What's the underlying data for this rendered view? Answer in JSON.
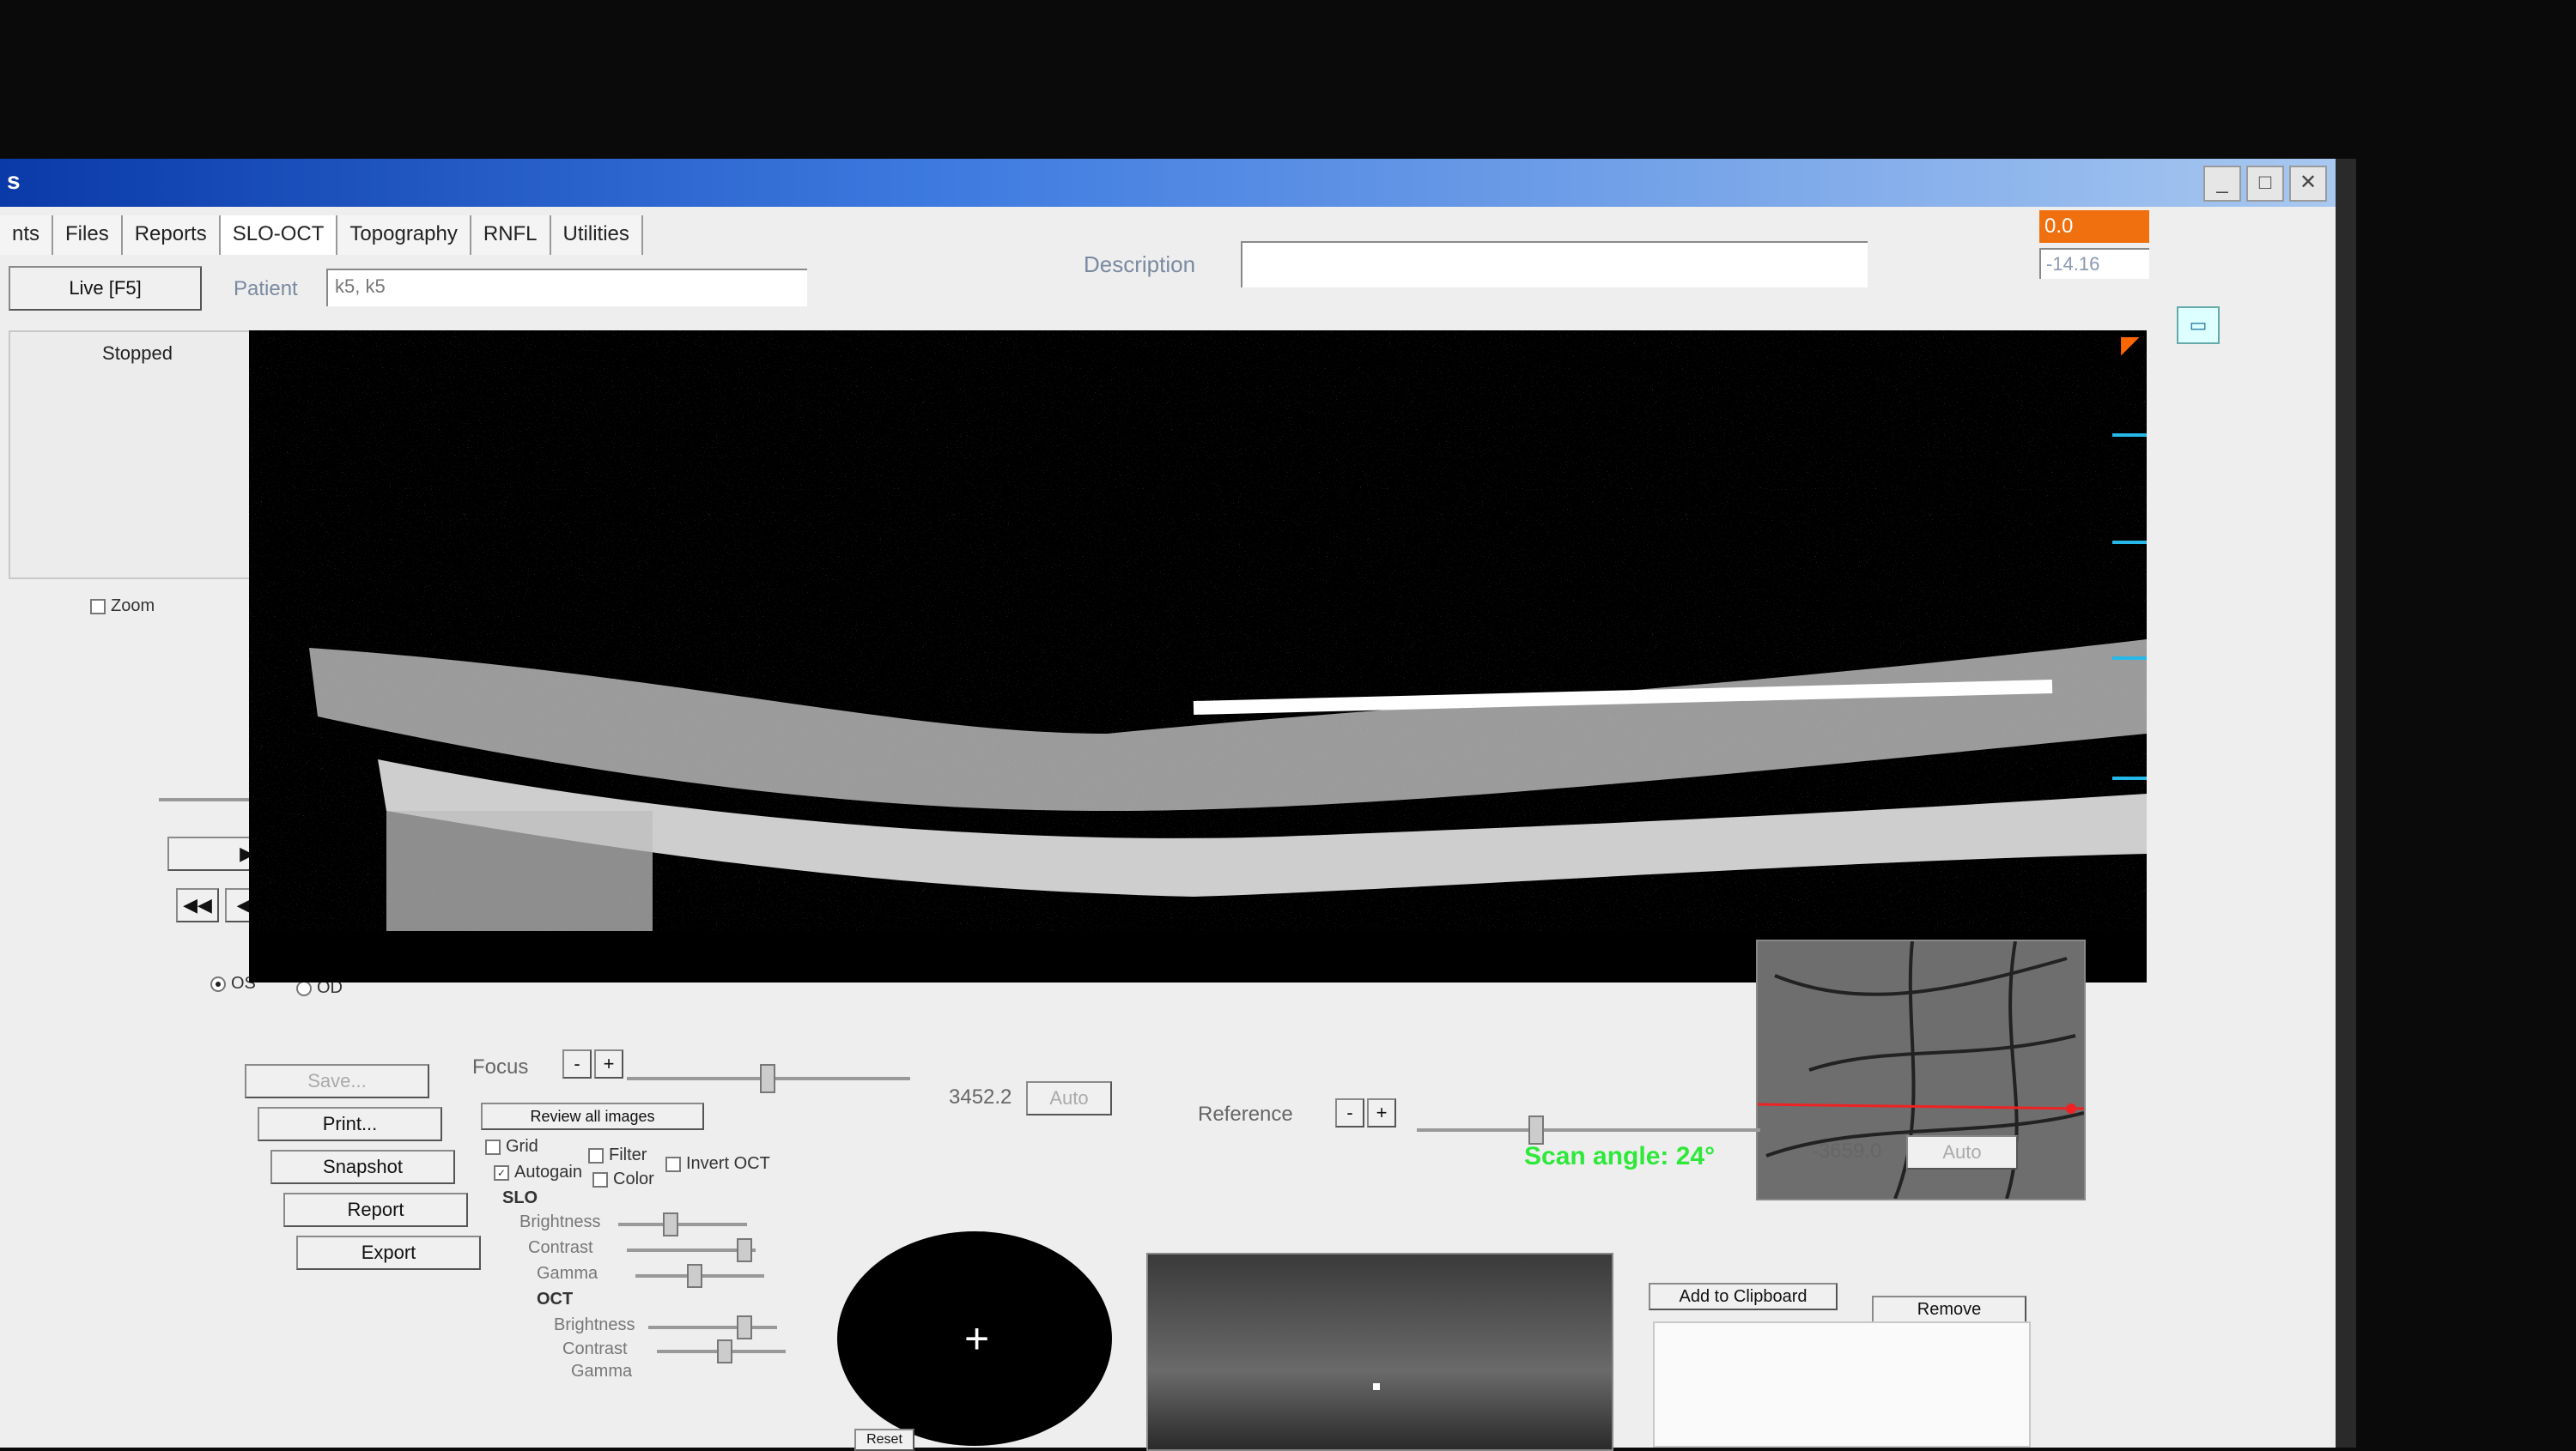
{
  "window": {
    "title": "s",
    "min": "_",
    "max": "□",
    "close": "✕"
  },
  "tabs": [
    "nts",
    "Files",
    "Reports",
    "SLO-OCT",
    "Topography",
    "RNFL",
    "Utilities"
  ],
  "header": {
    "patient_label": "Patient",
    "patient_value": "k5, k5",
    "description_label": "Description",
    "description_value": "",
    "readout_top": "0.0",
    "readout_bottom": "-14.16"
  },
  "left": {
    "live_button": "Live [F5]",
    "status": "Stopped",
    "zoom_label": "Zoom",
    "play_pause": "▶ / ||",
    "transport": [
      "◀◀",
      "◀|",
      "|▶",
      "▶▶"
    ],
    "eye_os": "OS",
    "eye_od": "OD",
    "buttons": [
      "Save...",
      "Print...",
      "Snapshot",
      "Report",
      "Export"
    ]
  },
  "image": {
    "scan_angle": "Scan angle: 24°"
  },
  "controls": {
    "focus_label": "Focus",
    "focus_value": "3452.2",
    "focus_auto": "Auto",
    "reference_label": "Reference",
    "reference_value": "-3659.0",
    "reference_auto": "Auto",
    "minus": "-",
    "plus": "+",
    "review_all": "Review all images",
    "grid": "Grid",
    "filter": "Filter",
    "autogain": "Autogain",
    "invert_oct": "Invert OCT",
    "color": "Color",
    "slo_label": "SLO",
    "oct_label": "OCT",
    "brightness": "Brightness",
    "contrast": "Contrast",
    "gamma": "Gamma",
    "reset": "Reset",
    "add_clipboard": "Add to Clipboard",
    "remove": "Remove"
  }
}
